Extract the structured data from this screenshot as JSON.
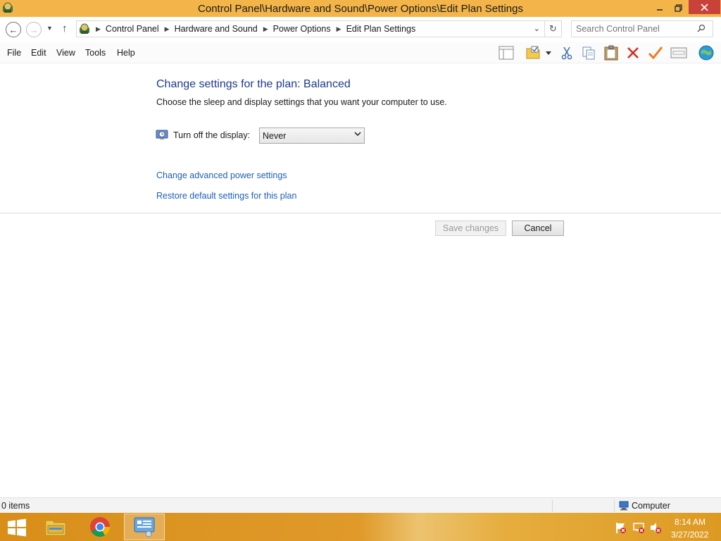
{
  "window": {
    "title": "Control Panel\\Hardware and Sound\\Power Options\\Edit Plan Settings",
    "minimize_icon": "minimize-icon",
    "restore_icon": "restore-icon",
    "close_icon": "close-icon"
  },
  "address": {
    "breadcrumbs": [
      "Control Panel",
      "Hardware and Sound",
      "Power Options",
      "Edit Plan Settings"
    ],
    "search_placeholder": "Search Control Panel"
  },
  "menu": {
    "file": "File",
    "edit": "Edit",
    "view": "View",
    "tools": "Tools",
    "help": "Help"
  },
  "toolbar_icons": [
    "layout-pane-icon",
    "folder-checked-icon",
    "dropdown-icon",
    "cut-icon",
    "copy-icon",
    "paste-icon",
    "delete-icon",
    "check-icon",
    "properties-icon",
    "globe-icon"
  ],
  "main": {
    "heading": "Change settings for the plan: Balanced",
    "subtext": "Choose the sleep and display settings that you want your computer to use.",
    "display_label": "Turn off the display:",
    "display_value": "Never",
    "link_advanced": "Change advanced power settings",
    "link_restore": "Restore default settings for this plan",
    "save_button": "Save changes",
    "cancel_button": "Cancel"
  },
  "status": {
    "count": "0 items",
    "location": "Computer"
  },
  "taskbar": {
    "apps": [
      "file-explorer-icon",
      "chrome-icon",
      "control-panel-icon"
    ],
    "time": "8:14 AM",
    "date": "3/27/2022"
  },
  "colors": {
    "title_bar": "#f3b54a",
    "heading": "#1e3a8c",
    "link": "#1d5fb8",
    "close_button": "#c8423a",
    "taskbar": "#e09a2a"
  }
}
